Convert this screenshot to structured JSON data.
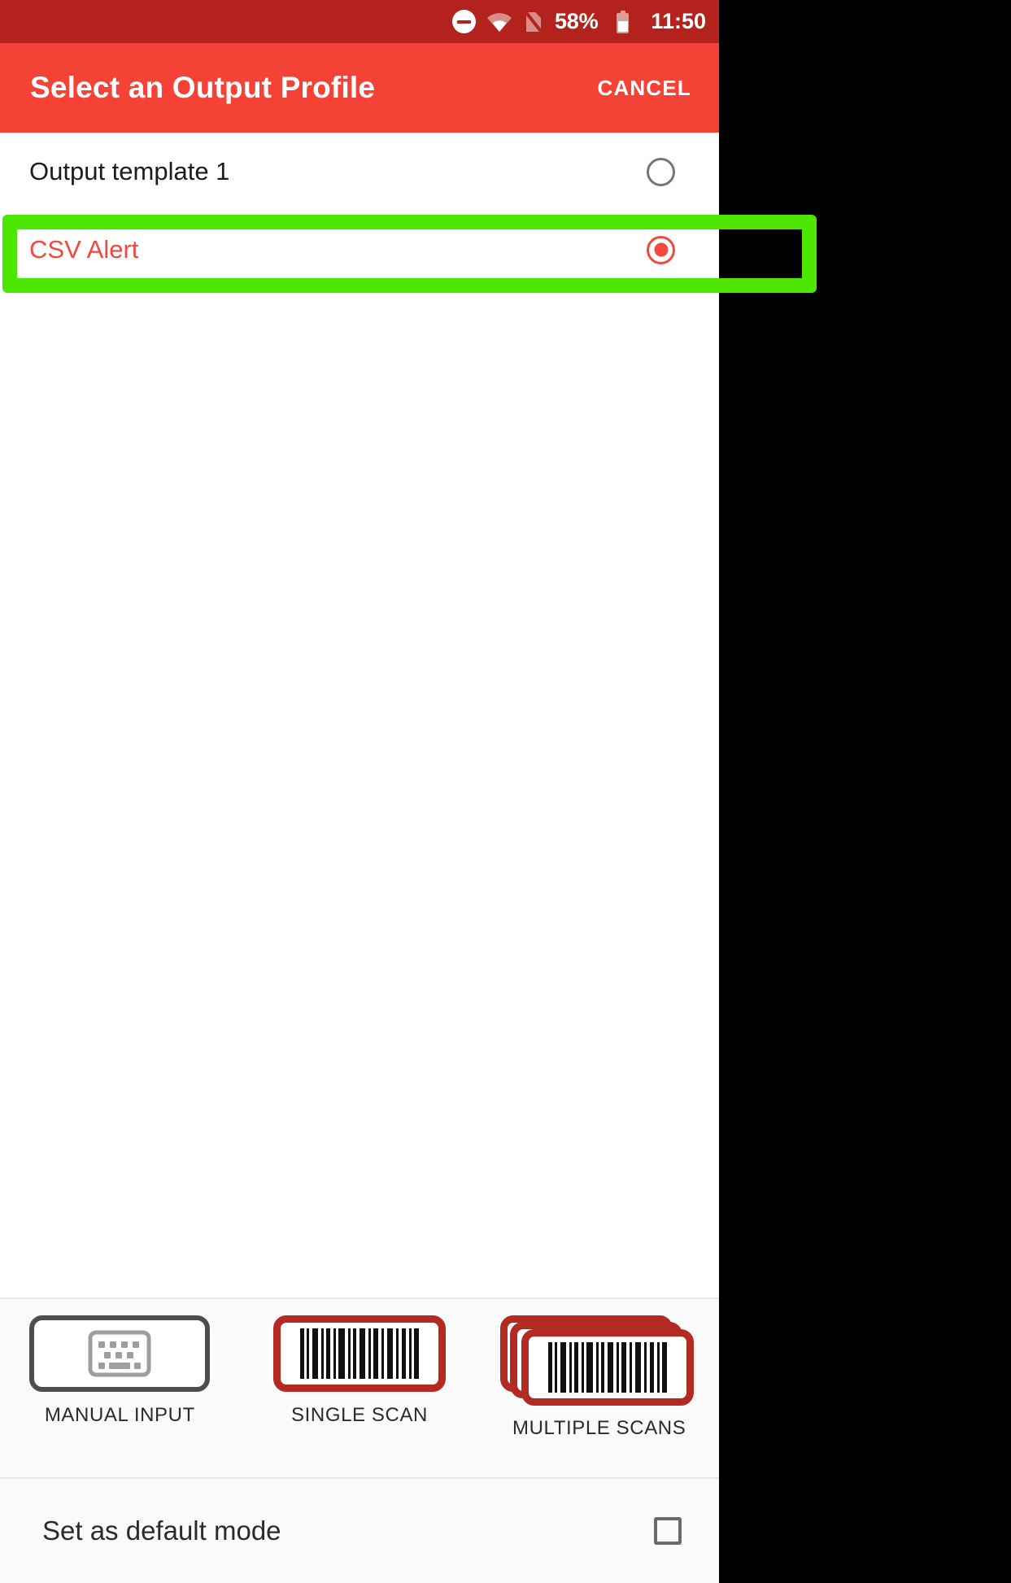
{
  "statusbar": {
    "dnd_icon": "do-not-disturb-icon",
    "wifi_icon": "wifi-icon",
    "sim_icon": "sim-off-icon",
    "battery_percent": "58%",
    "battery_icon": "battery-icon",
    "time": "11:50",
    "background_color": "#b3221d"
  },
  "appbar": {
    "title": "Select an Output Profile",
    "cancel_label": "CANCEL",
    "background_color": "#f44336"
  },
  "profiles": [
    {
      "label": "Output template 1",
      "selected": false
    },
    {
      "label": "CSV Alert",
      "selected": true
    }
  ],
  "annotation": {
    "color": "#4ce600",
    "target": "CSV Alert"
  },
  "modes": [
    {
      "label": "MANUAL INPUT",
      "icon": "keyboard-icon"
    },
    {
      "label": "SINGLE SCAN",
      "icon": "barcode-icon"
    },
    {
      "label": "MULTIPLE SCANS",
      "icon": "barcode-stack-icon"
    }
  ],
  "default_mode": {
    "label": "Set as default mode",
    "checked": false
  },
  "colors": {
    "accent": "#f4483c",
    "status_bar": "#b3221d",
    "barcode_frame": "#b32a22",
    "highlight": "#4ce600"
  }
}
